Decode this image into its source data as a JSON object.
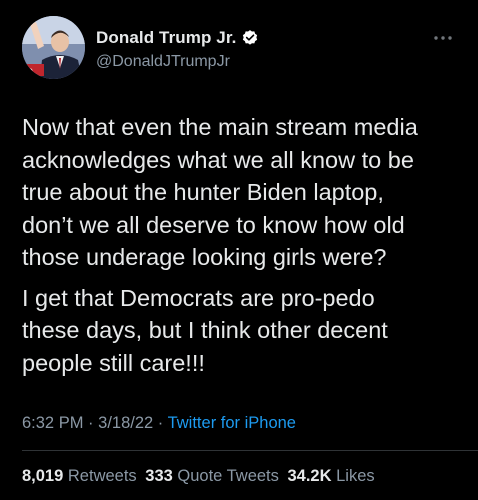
{
  "author": {
    "display_name": "Donald Trump Jr.",
    "handle": "@DonaldJTrumpJr",
    "verified": true,
    "avatar_icon": "profile-photo"
  },
  "tweet": {
    "paragraphs": [
      "Now that even the main stream media\nacknowledges what we all know to be\ntrue about the hunter Biden laptop,\ndon’t we all deserve to know how old\nthose underage looking girls were?",
      "I get that Democrats are pro-pedo\nthese days, but I think other decent\npeople still care!!!"
    ]
  },
  "meta": {
    "time": "6:32 PM",
    "separator": "·",
    "date": "3/18/22",
    "source": "Twitter for iPhone"
  },
  "stats": {
    "retweets_count": "8,019",
    "retweets_label": "Retweets",
    "quotes_count": "333",
    "quotes_label": "Quote Tweets",
    "likes_count": "34.2K",
    "likes_label": "Likes"
  },
  "colors": {
    "background": "#000000",
    "text": "#e7e9ea",
    "muted": "#8b98a5",
    "link": "#1d9bf0",
    "divider": "#2f3336"
  }
}
